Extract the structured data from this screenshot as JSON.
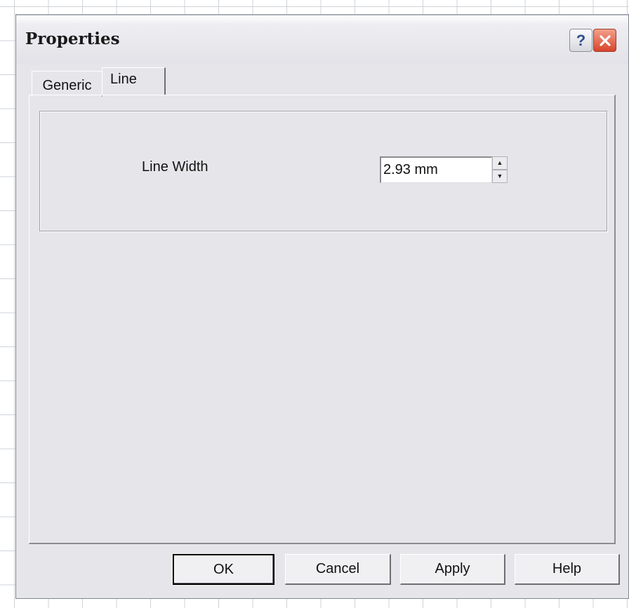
{
  "dialog": {
    "title": "Properties",
    "help_glyph": "?",
    "close_glyph": "close-icon"
  },
  "tabs": [
    {
      "label": "Generic",
      "active": false
    },
    {
      "label": "Line",
      "active": true
    }
  ],
  "line_tab": {
    "line_width_label": "Line Width",
    "line_width_value": "2.93 mm"
  },
  "buttons": {
    "ok": "OK",
    "cancel": "Cancel",
    "apply": "Apply",
    "help": "Help"
  },
  "colors": {
    "dialog_bg": "#e6e6ea",
    "close_button": "#d8452a"
  }
}
